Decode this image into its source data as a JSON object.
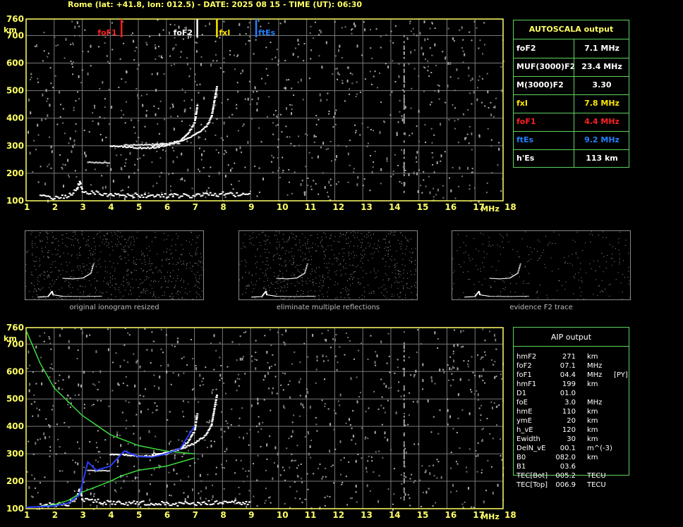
{
  "header": {
    "title": "Rome (lat: +41.8, lon: 012.5) - DATE: 2025 08 15 - TIME (UT): 06:30"
  },
  "colors": {
    "grid": "#787878",
    "border": "#ffff66",
    "green": "#3cdc3c",
    "blue": "#2a3cff",
    "red": "#ff2020",
    "yellow": "#ffe600",
    "fte": "#2080ff"
  },
  "autoscala": {
    "title": "AUTOSCALA output",
    "rows": [
      {
        "key": "foF2",
        "value": "7.1 MHz",
        "color": "#ffffff"
      },
      {
        "key": "MUF(3000)F2",
        "value": "23.4 MHz",
        "color": "#ffffff"
      },
      {
        "key": "M(3000)F2",
        "value": "3.30",
        "color": "#ffffff"
      },
      {
        "key": "fxI",
        "value": "7.8 MHz",
        "color": "#ffe600"
      },
      {
        "key": "foF1",
        "value": "4.4 MHz",
        "color": "#ff2020"
      },
      {
        "key": "ftEs",
        "value": "9.2 MHz",
        "color": "#2080ff"
      },
      {
        "key": "h'Es",
        "value": "113    km",
        "color": "#ffffff"
      }
    ]
  },
  "aip": {
    "title": "AIP output",
    "rows": [
      {
        "k": "hmF2",
        "v": "271",
        "u": "km",
        "x": ""
      },
      {
        "k": "foF2",
        "v": "07.1",
        "u": "MHz",
        "x": ""
      },
      {
        "k": "foF1",
        "v": "04.4",
        "u": "MHz",
        "x": "[PY]"
      },
      {
        "k": "hmF1",
        "v": "199",
        "u": "km",
        "x": ""
      },
      {
        "k": "D1",
        "v": "01.0",
        "u": "",
        "x": ""
      },
      {
        "k": "foE",
        "v": "3.0",
        "u": "MHz",
        "x": ""
      },
      {
        "k": "hmE",
        "v": "110",
        "u": "km",
        "x": ""
      },
      {
        "k": "ymE",
        "v": "20",
        "u": "km",
        "x": ""
      },
      {
        "k": "h_vE",
        "v": "120",
        "u": "km",
        "x": ""
      },
      {
        "k": "Ewidth",
        "v": "30",
        "u": "km",
        "x": ""
      },
      {
        "k": "DelN_vE",
        "v": "00.1",
        "u": "m^(-3)",
        "x": ""
      },
      {
        "k": "B0",
        "v": "082.0",
        "u": "km",
        "x": ""
      },
      {
        "k": "B1",
        "v": "03.6",
        "u": "",
        "x": ""
      },
      {
        "k": "TEC[Bot]",
        "v": "005.2",
        "u": "TECU",
        "x": ""
      },
      {
        "k": "TEC[Top]",
        "v": "006.9",
        "u": "TECU",
        "x": ""
      }
    ]
  },
  "thumb_captions": [
    "original ionogram resized",
    "eliminate multiple reflections",
    "evidence F2 trace"
  ],
  "chart_data": [
    {
      "type": "scatter",
      "title": "",
      "xlabel": "MHz",
      "ylabel": "km",
      "xlim": [
        1,
        18
      ],
      "ylim": [
        100,
        760
      ],
      "xticks": [
        1,
        2,
        3,
        4,
        5,
        6,
        7,
        8,
        9,
        10,
        11,
        12,
        13,
        14,
        15,
        16,
        17,
        18
      ],
      "yticks": [
        100,
        200,
        300,
        400,
        500,
        600,
        700,
        760
      ],
      "grid": true,
      "markers": [
        {
          "name": "foF1",
          "x": 4.4,
          "color": "#ff2020"
        },
        {
          "name": "foF2",
          "x": 7.1,
          "color": "#ffffff"
        },
        {
          "name": "fxI",
          "x": 7.8,
          "color": "#ffe600"
        },
        {
          "name": "ftEs",
          "x": 9.2,
          "color": "#2080ff"
        }
      ],
      "series": [
        {
          "name": "O-trace",
          "x": [
            4.0,
            4.5,
            5.0,
            5.5,
            6.0,
            6.5,
            6.8,
            7.0,
            7.1
          ],
          "y": [
            298,
            296,
            292,
            292,
            300,
            318,
            348,
            385,
            450
          ]
        },
        {
          "name": "X-trace",
          "x": [
            5.5,
            6.0,
            6.5,
            7.0,
            7.4,
            7.6,
            7.8
          ],
          "y": [
            300,
            305,
            318,
            338,
            368,
            405,
            520
          ]
        },
        {
          "name": "Es-trace",
          "x": [
            1.5,
            2.0,
            2.5,
            2.8,
            2.9,
            3.0,
            4.0,
            5.0,
            6.0,
            7.0,
            8.0,
            9.0
          ],
          "y": [
            113,
            113,
            118,
            140,
            170,
            135,
            120,
            120,
            118,
            118,
            125,
            120
          ]
        }
      ]
    },
    {
      "type": "scatter",
      "title": "",
      "xlabel": "MHz",
      "ylabel": "km",
      "xlim": [
        1,
        18
      ],
      "ylim": [
        100,
        760
      ],
      "xticks": [
        1,
        2,
        3,
        4,
        5,
        6,
        7,
        8,
        9,
        10,
        11,
        12,
        13,
        14,
        15,
        16,
        17,
        18
      ],
      "yticks": [
        100,
        200,
        300,
        400,
        500,
        600,
        700,
        760
      ],
      "grid": true,
      "series": [
        {
          "name": "profile",
          "x": [
            1.0,
            1.5,
            2.0,
            3.0,
            4.0,
            5.0,
            6.0,
            7.0
          ],
          "y": [
            750,
            630,
            540,
            440,
            370,
            330,
            310,
            300
          ]
        },
        {
          "name": "profile-lower",
          "x": [
            7.0,
            6.0,
            5.0,
            4.4,
            4.0,
            3.0,
            2.5,
            2.0,
            1.5,
            1.0
          ],
          "y": [
            285,
            255,
            240,
            220,
            200,
            160,
            130,
            115,
            108,
            105
          ]
        },
        {
          "name": "model-trace",
          "x": [
            1.0,
            2.0,
            2.5,
            2.9,
            3.2,
            3.5,
            4.0,
            4.5,
            5.0,
            5.5,
            6.0,
            6.5,
            7.0
          ],
          "y": [
            105,
            110,
            120,
            150,
            270,
            240,
            255,
            310,
            290,
            288,
            300,
            320,
            400
          ]
        }
      ]
    }
  ]
}
